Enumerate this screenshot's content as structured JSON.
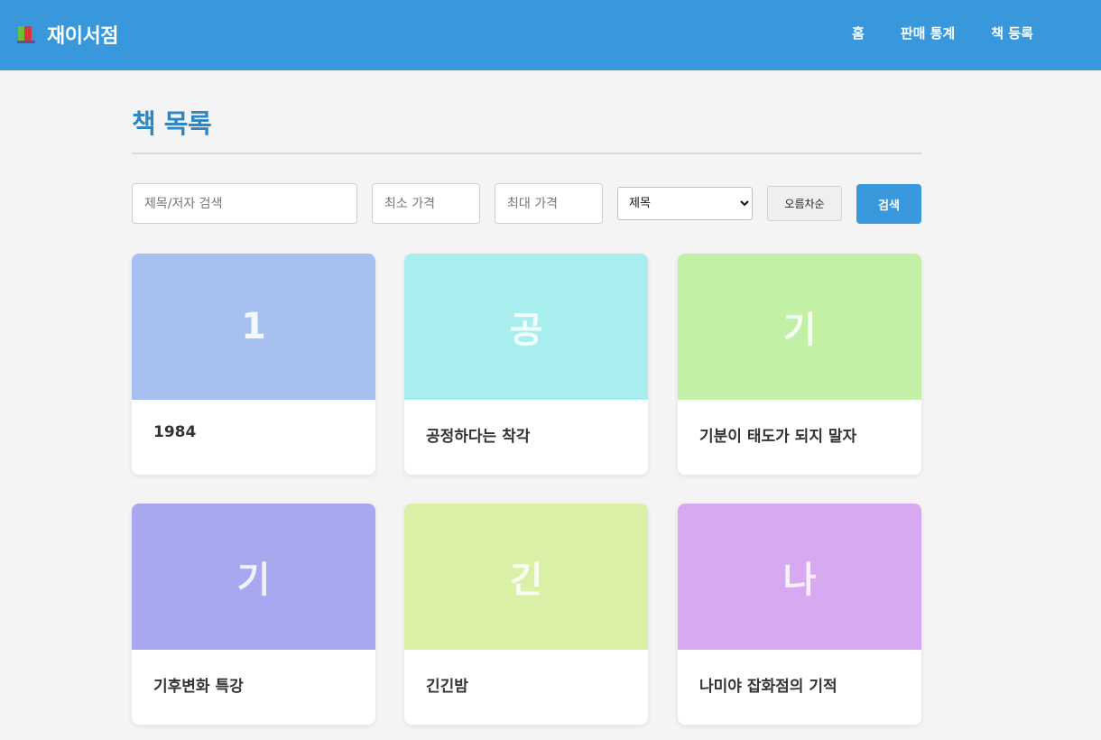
{
  "header": {
    "brand_icon": "books-icon",
    "brand": "재이서점",
    "nav": [
      "홈",
      "판매 통계",
      "책 등록"
    ]
  },
  "page_title": "책 목록",
  "filters": {
    "search_placeholder": "제목/저자 검색",
    "min_price_placeholder": "최소 가격",
    "max_price_placeholder": "최대 가격",
    "sort_selected": "제목",
    "order_label": "오름차순",
    "search_button": "검색"
  },
  "books": [
    {
      "initial": "1",
      "title": "1984",
      "color": "#a8c0f0"
    },
    {
      "initial": "공",
      "title": "공정하다는 착각",
      "color": "#a8eeee"
    },
    {
      "initial": "기",
      "title": "기분이 태도가 되지 말자",
      "color": "#c2f0a6"
    },
    {
      "initial": "기",
      "title": "기후변화 특강",
      "color": "#a8a8f0"
    },
    {
      "initial": "긴",
      "title": "긴긴밤",
      "color": "#d9f0a6"
    },
    {
      "initial": "나",
      "title": "나미야 잡화점의 기적",
      "color": "#d8a8f0"
    }
  ],
  "colors": {
    "header_bg": "#3898db",
    "title": "#2f86c5",
    "page_bg": "#f4f4f4"
  }
}
